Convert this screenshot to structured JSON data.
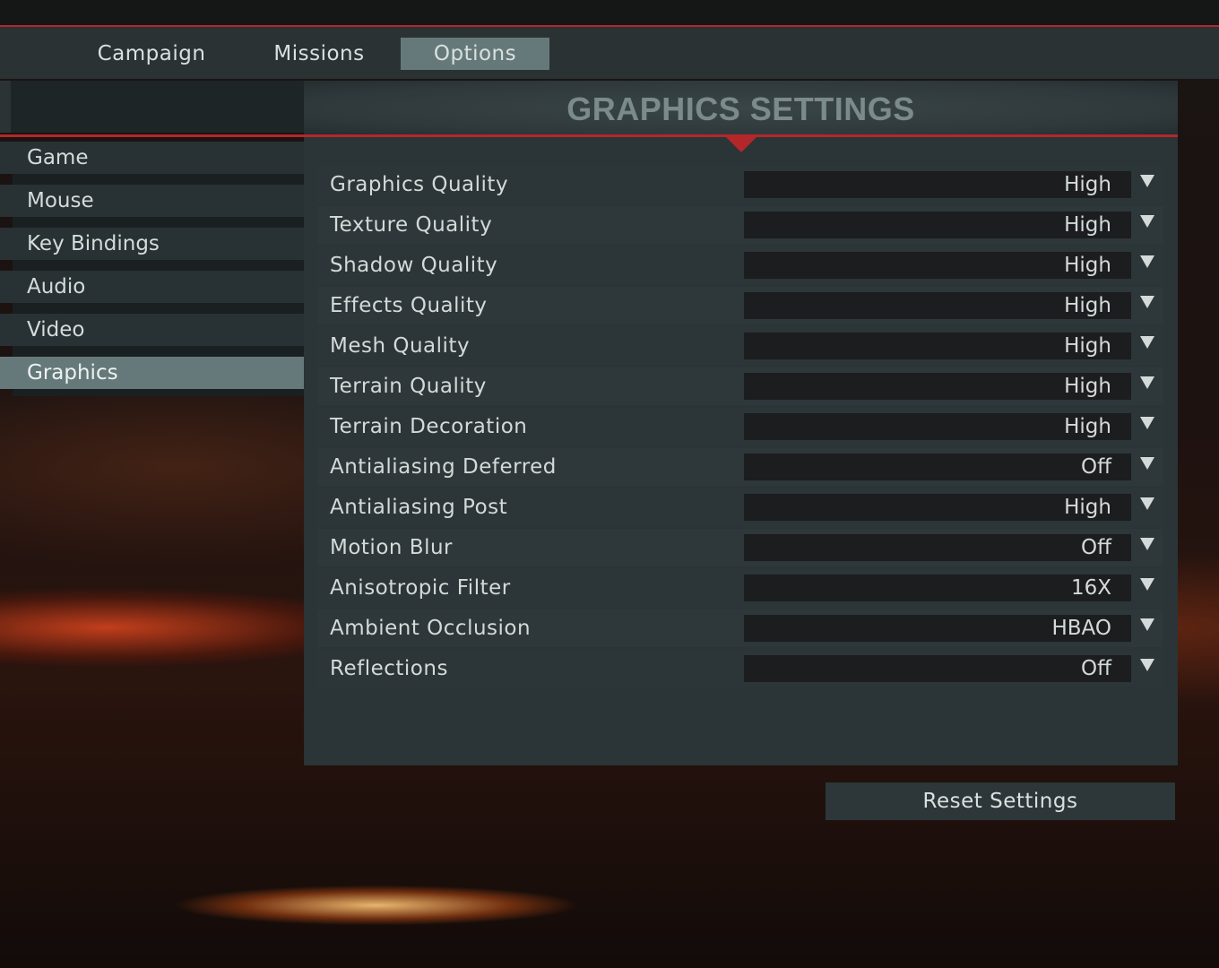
{
  "nav": {
    "tabs": [
      {
        "label": "Campaign"
      },
      {
        "label": "Missions"
      },
      {
        "label": "Options"
      }
    ]
  },
  "sidebar": {
    "items": [
      {
        "label": "Game"
      },
      {
        "label": "Mouse"
      },
      {
        "label": "Key Bindings"
      },
      {
        "label": "Audio"
      },
      {
        "label": "Video"
      },
      {
        "label": "Graphics"
      }
    ]
  },
  "panel": {
    "title": "GRAPHICS SETTINGS",
    "settings": [
      {
        "label": "Graphics Quality",
        "value": "High"
      },
      {
        "label": "Texture Quality",
        "value": "High"
      },
      {
        "label": "Shadow Quality",
        "value": "High"
      },
      {
        "label": "Effects Quality",
        "value": "High"
      },
      {
        "label": "Mesh Quality",
        "value": "High"
      },
      {
        "label": "Terrain Quality",
        "value": "High"
      },
      {
        "label": "Terrain Decoration",
        "value": "High"
      },
      {
        "label": "Antialiasing Deferred",
        "value": "Off"
      },
      {
        "label": "Antialiasing Post",
        "value": "High"
      },
      {
        "label": "Motion Blur",
        "value": "Off"
      },
      {
        "label": "Anisotropic Filter",
        "value": "16X"
      },
      {
        "label": "Ambient Occlusion",
        "value": "HBAO"
      },
      {
        "label": "Reflections",
        "value": "Off"
      }
    ]
  },
  "footer": {
    "reset_label": "Reset Settings"
  },
  "theme": {
    "accent": "#b3272a",
    "active_tab": "#66797a",
    "panel_bg": "#2b3436"
  },
  "icons": {
    "dropdown": "chevron-down-icon"
  }
}
